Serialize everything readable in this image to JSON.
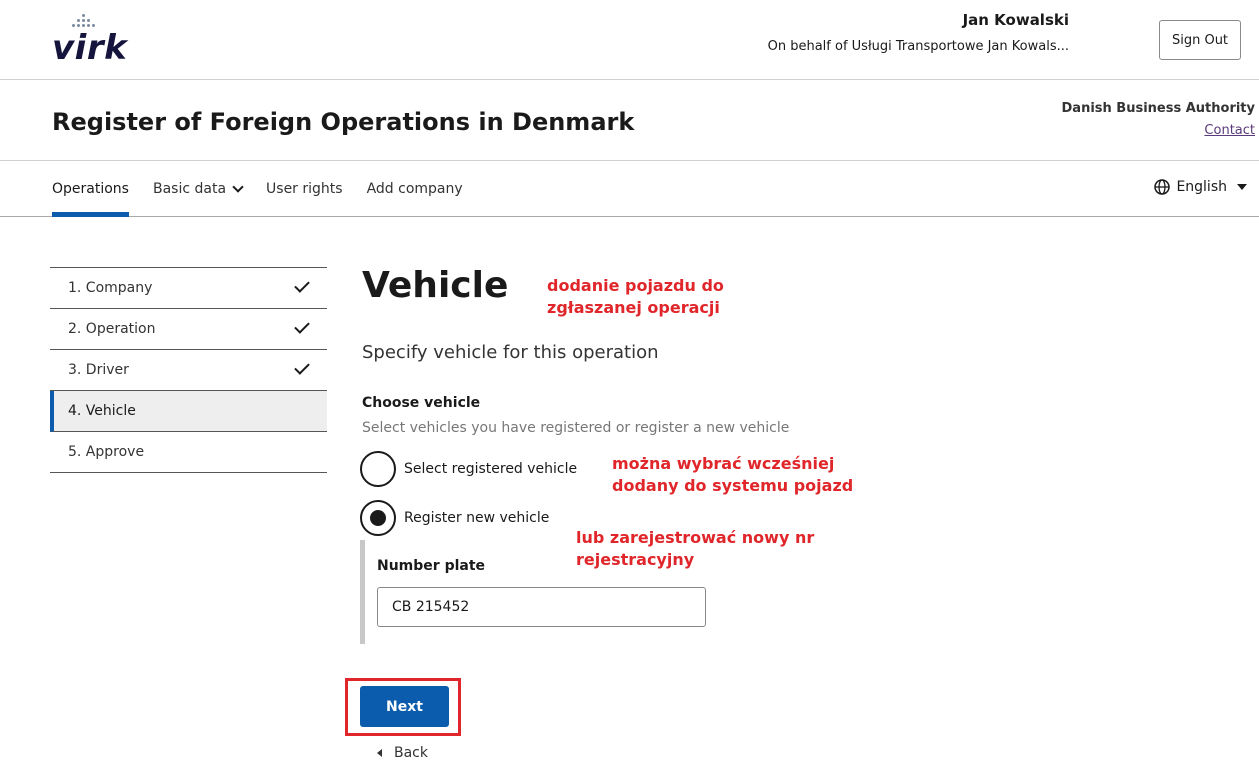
{
  "header": {
    "logo_text": "virk",
    "user_name": "Jan Kowalski",
    "on_behalf": "On behalf of Usługi Transportowe Jan Kowals...",
    "sign_out": "Sign Out"
  },
  "title_row": {
    "app_title": "Register of Foreign Operations in Denmark",
    "authority": "Danish Business Authority",
    "contact": "Contact"
  },
  "nav": {
    "items": [
      "Operations",
      "Basic data",
      "User rights",
      "Add company"
    ],
    "active": "Operations",
    "language": "English"
  },
  "steps": [
    {
      "label": "1. Company",
      "done": true
    },
    {
      "label": "2. Operation",
      "done": true
    },
    {
      "label": "3. Driver",
      "done": true
    },
    {
      "label": "4. Vehicle",
      "done": false,
      "current": true
    },
    {
      "label": "5. Approve",
      "done": false
    }
  ],
  "main": {
    "title": "Vehicle",
    "subtitle": "Specify vehicle for this operation",
    "choose_label": "Choose vehicle",
    "choose_hint": "Select vehicles you have registered or register a new vehicle",
    "options": [
      {
        "label": "Select registered vehicle",
        "checked": false
      },
      {
        "label": "Register new vehicle",
        "checked": true
      }
    ],
    "plate_label": "Number plate",
    "plate_value": "CB 215452",
    "next": "Next",
    "back": "Back"
  },
  "annotations": {
    "a1_line1": "dodanie pojazdu do",
    "a1_line2": "zgłaszanej operacji",
    "a2_line1": "można wybrać wcześniej",
    "a2_line2": "dodany do systemu pojazd",
    "a3_line1": "lub zarejestrować nowy nr",
    "a3_line2": "rejestracyjny"
  },
  "colors": {
    "accent": "#0b5cad",
    "annotation": "#e0262a"
  }
}
